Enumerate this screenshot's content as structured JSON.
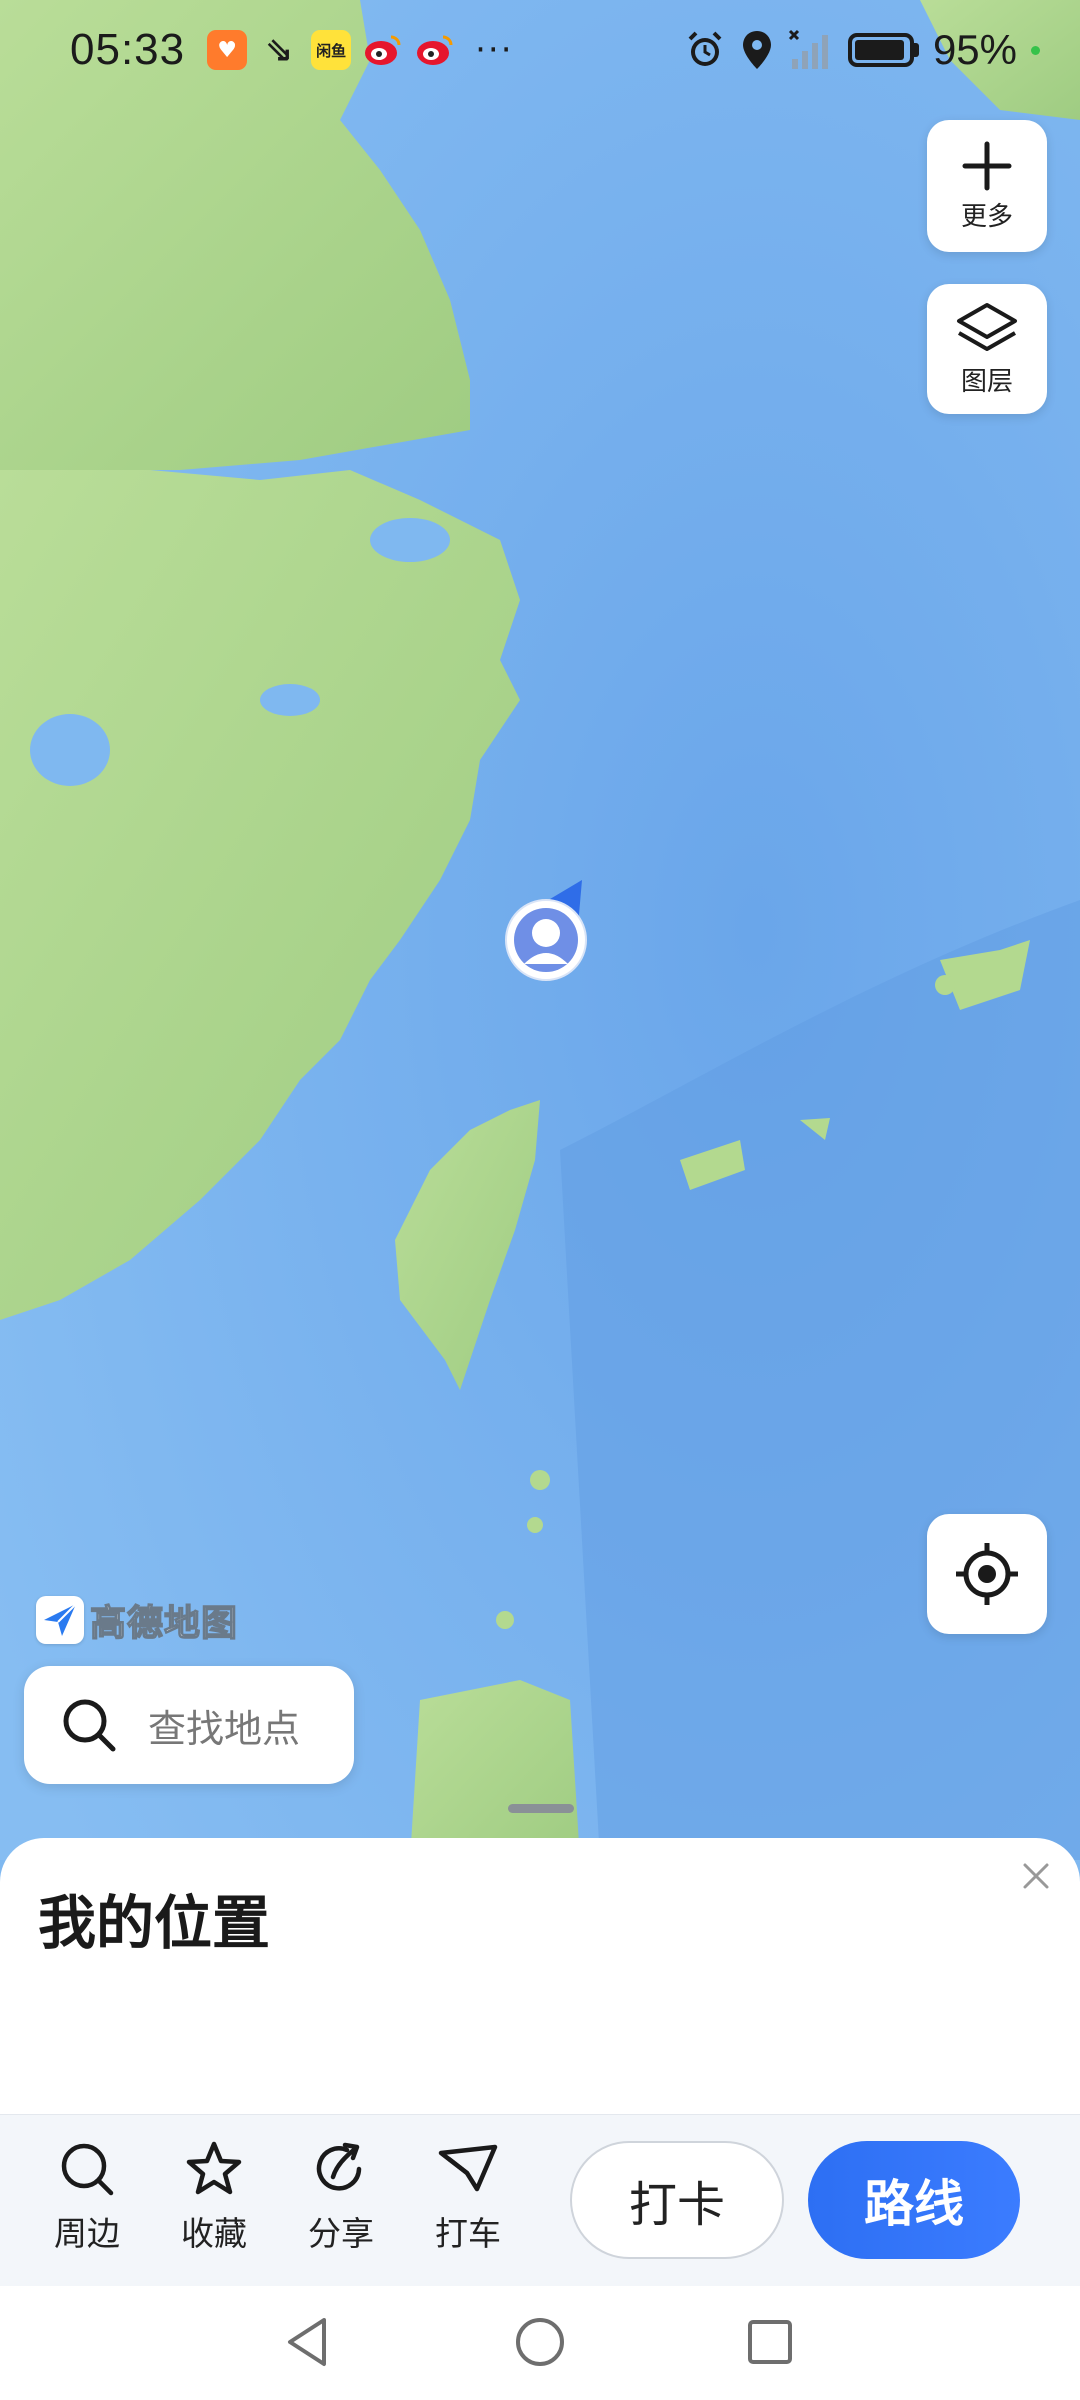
{
  "status_bar": {
    "time": "05:33",
    "notif_icons": [
      "taobao-icon",
      "app-icon",
      "xianyu-icon",
      "weibo-icon",
      "weibo-icon"
    ],
    "xianyu_text": "闲鱼",
    "more": "···",
    "battery": "95%",
    "battery_level": 0.95
  },
  "map_controls": {
    "more_label": "更多",
    "layers_label": "图层"
  },
  "logo": {
    "text": "高德地图"
  },
  "search": {
    "placeholder": "查找地点"
  },
  "sheet": {
    "title": "我的位置",
    "actions": [
      {
        "label": "周边",
        "icon": "search-icon"
      },
      {
        "label": "收藏",
        "icon": "star-icon"
      },
      {
        "label": "分享",
        "icon": "share-icon"
      },
      {
        "label": "打车",
        "icon": "taxi-icon"
      }
    ],
    "checkin_label": "打卡",
    "route_label": "路线"
  },
  "colors": {
    "route_button": "#2d6ff3",
    "sea": "#7fb8f0",
    "land": "#aed78f"
  }
}
